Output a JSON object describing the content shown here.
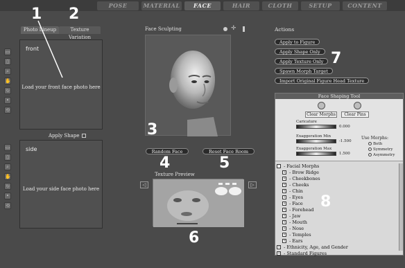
{
  "room_tabs": [
    "POSE",
    "MATERIAL",
    "FACE",
    "HAIR",
    "CLOTH",
    "SETUP",
    "CONTENT"
  ],
  "active_tab": "FACE",
  "left_tabs": {
    "photo_lineup": "Photo Lineup",
    "texture_variation": "Texture Variation"
  },
  "front_box": {
    "label": "front",
    "hint": "Load your front face photo here"
  },
  "apply_shape": "Apply Shape",
  "side_box": {
    "label": "side",
    "hint": "Load your side face photo here"
  },
  "face_sculpting": {
    "title": "Face Sculpting",
    "random_face": "Random Face",
    "reset_face_room": "Reset Face Room"
  },
  "texture_preview": {
    "title": "Texture Preview"
  },
  "actions": {
    "title": "Actions",
    "buttons": [
      "Apply to Figure",
      "Apply Shape Only",
      "Apply Texture Only",
      "Spawn Morph Target",
      "Import Original Figure Head Texture"
    ]
  },
  "face_shaping_tool": {
    "title": "Face Shaping Tool",
    "clear_morphs": "Clear  Morphs",
    "clear_pins": "Clear  Pins",
    "caricature_label": "Caricature",
    "caricature_value": "0.000",
    "exag_min_label": "Exaggeration Min",
    "exag_min_value": "-1.500",
    "exag_max_label": "Exaggeration Max",
    "exag_max_value": "1.500",
    "use_morphs": "Use Morphs:",
    "radio_both": "Both",
    "radio_symmetry": "Symmetry",
    "radio_asymmetry": "Asymmetry",
    "tree": [
      {
        "sign": "-",
        "label": "Facial Morphs",
        "indent": 0
      },
      {
        "sign": "+",
        "label": "Brow Ridge",
        "indent": 1
      },
      {
        "sign": "+",
        "label": "Cheekbones",
        "indent": 1
      },
      {
        "sign": "+",
        "label": "Cheeks",
        "indent": 1
      },
      {
        "sign": "+",
        "label": "Chin",
        "indent": 1
      },
      {
        "sign": "+",
        "label": "Eyes",
        "indent": 1
      },
      {
        "sign": "+",
        "label": "Face",
        "indent": 1
      },
      {
        "sign": "+",
        "label": "Forehead",
        "indent": 1
      },
      {
        "sign": "+",
        "label": "Jaw",
        "indent": 1
      },
      {
        "sign": "+",
        "label": "Mouth",
        "indent": 1
      },
      {
        "sign": "+",
        "label": "Nose",
        "indent": 1
      },
      {
        "sign": "+",
        "label": "Temples",
        "indent": 1
      },
      {
        "sign": "+",
        "label": "Ears",
        "indent": 1
      },
      {
        "sign": "+",
        "label": "Ethnicity, Age, and Gender",
        "indent": 0
      },
      {
        "sign": "+",
        "label": "Standard Figures",
        "indent": 0
      }
    ]
  },
  "callouts": [
    "1",
    "2",
    "3",
    "4",
    "5",
    "6",
    "7",
    "8"
  ]
}
